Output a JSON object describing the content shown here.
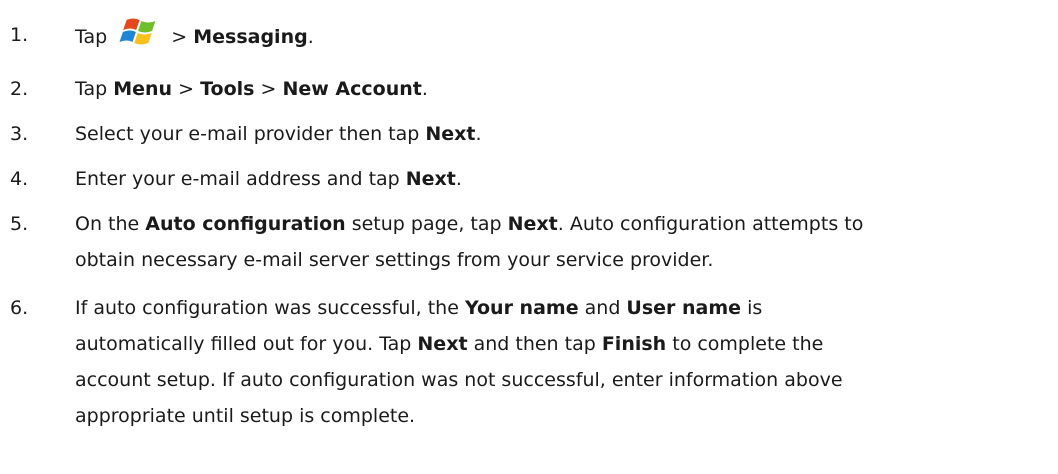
{
  "steps": [
    {
      "number": "1.",
      "segments": [
        {
          "text": "Tap ",
          "bold": false
        },
        {
          "icon": "windows-start-icon"
        },
        {
          "text": " > ",
          "bold": false
        },
        {
          "text": "Messaging",
          "bold": true
        },
        {
          "text": ".",
          "bold": false
        }
      ]
    },
    {
      "number": "2.",
      "segments": [
        {
          "text": "Tap ",
          "bold": false
        },
        {
          "text": "Menu",
          "bold": true
        },
        {
          "text": " > ",
          "bold": false
        },
        {
          "text": "Tools",
          "bold": true
        },
        {
          "text": " > ",
          "bold": false
        },
        {
          "text": "New Account",
          "bold": true
        },
        {
          "text": ".",
          "bold": false
        }
      ]
    },
    {
      "number": "3.",
      "segments": [
        {
          "text": "Select your e-mail provider then tap ",
          "bold": false
        },
        {
          "text": "Next",
          "bold": true
        },
        {
          "text": ".",
          "bold": false
        }
      ]
    },
    {
      "number": "4.",
      "segments": [
        {
          "text": "Enter your e-mail address and tap ",
          "bold": false
        },
        {
          "text": "Next",
          "bold": true
        },
        {
          "text": ".",
          "bold": false
        }
      ]
    },
    {
      "number": "5.",
      "lines": [
        [
          {
            "text": "On the ",
            "bold": false
          },
          {
            "text": "Auto configuration",
            "bold": true
          },
          {
            "text": " setup page, tap ",
            "bold": false
          },
          {
            "text": "Next",
            "bold": true
          },
          {
            "text": ". Auto configuration attempts to",
            "bold": false
          }
        ],
        [
          {
            "text": "obtain necessary e-mail server settings from your service provider.",
            "bold": false
          }
        ]
      ]
    },
    {
      "number": "6.",
      "lines": [
        [
          {
            "text": "If auto configuration was successful, the ",
            "bold": false
          },
          {
            "text": "Your name",
            "bold": true
          },
          {
            "text": " and ",
            "bold": false
          },
          {
            "text": "User name",
            "bold": true
          },
          {
            "text": " is",
            "bold": false
          }
        ],
        [
          {
            "text": "automatically filled out for you. Tap ",
            "bold": false
          },
          {
            "text": "Next",
            "bold": true
          },
          {
            "text": " and then tap ",
            "bold": false
          },
          {
            "text": "Finish",
            "bold": true
          },
          {
            "text": " to complete the",
            "bold": false
          }
        ],
        [
          {
            "text": "account setup. If auto configuration was not successful, enter information above",
            "bold": false
          }
        ],
        [
          {
            "text": "appropriate until setup is complete.",
            "bold": false
          }
        ]
      ]
    }
  ]
}
